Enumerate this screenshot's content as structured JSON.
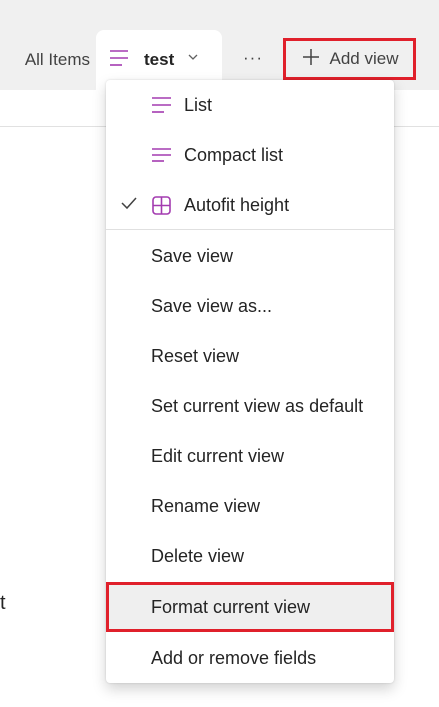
{
  "tabs": {
    "all_items": "All Items",
    "active_label": "test",
    "more": "···",
    "add_view": "Add view"
  },
  "background_text": "t",
  "menu": {
    "items": [
      {
        "label": "List",
        "icon": "list-icon"
      },
      {
        "label": "Compact list",
        "icon": "compact-list-icon"
      },
      {
        "label": "Autofit height",
        "icon": "autofit-height-icon",
        "checked": true
      },
      {
        "label": "Save view"
      },
      {
        "label": "Save view as..."
      },
      {
        "label": "Reset view"
      },
      {
        "label": "Set current view as default"
      },
      {
        "label": "Edit current view"
      },
      {
        "label": "Rename view"
      },
      {
        "label": "Delete view"
      },
      {
        "label": "Format current view",
        "highlighted": true
      },
      {
        "label": "Add or remove fields"
      }
    ]
  },
  "colors": {
    "accent": "#a33bb0",
    "highlight_border": "#e0202b",
    "topbar_bg": "#f0f0f0"
  }
}
